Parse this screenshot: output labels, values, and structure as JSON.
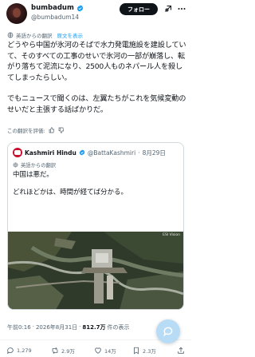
{
  "author": {
    "display_name": "bumbadum",
    "handle": "@bumbadum14"
  },
  "follow_label": "フォロー",
  "translation": {
    "label": "英語からの翻訳",
    "original_link": "原文を表示"
  },
  "body": [
    "どうやら中国が氷河のそばで水力発電施設を建設していて、そのすべての工事のせいで氷河の一部が崩落し、転がり落ちて泥流になり、2500人ものネパール人を殺してしまったらしい。",
    "でもニュースで聞くのは、左翼たちがこれを気候変動のせいだと主張する話ばかりだ。"
  ],
  "rate_translation": "この翻訳を評価:",
  "quote": {
    "display_name": "Kashmiri Hindu",
    "handle": "@BattaKashmiri",
    "dot": "·",
    "date": "8月29日",
    "translation_label": "英語からの翻訳",
    "text": [
      "中国は悪だ。",
      "どれほどかは、時間が経てば分かる。"
    ],
    "image_credit": "ESI Vision"
  },
  "meta": {
    "time": "午前0:16",
    "date": "2026年8月31日",
    "views": "812.7万",
    "views_label": "件の表示"
  },
  "actions": {
    "replies": "1,279",
    "reposts": "2.9万",
    "likes": "14万",
    "bookmarks": "2.3万"
  },
  "colors": {
    "accent": "#1d9bf0",
    "text": "#0f1419",
    "secondary": "#536471"
  }
}
